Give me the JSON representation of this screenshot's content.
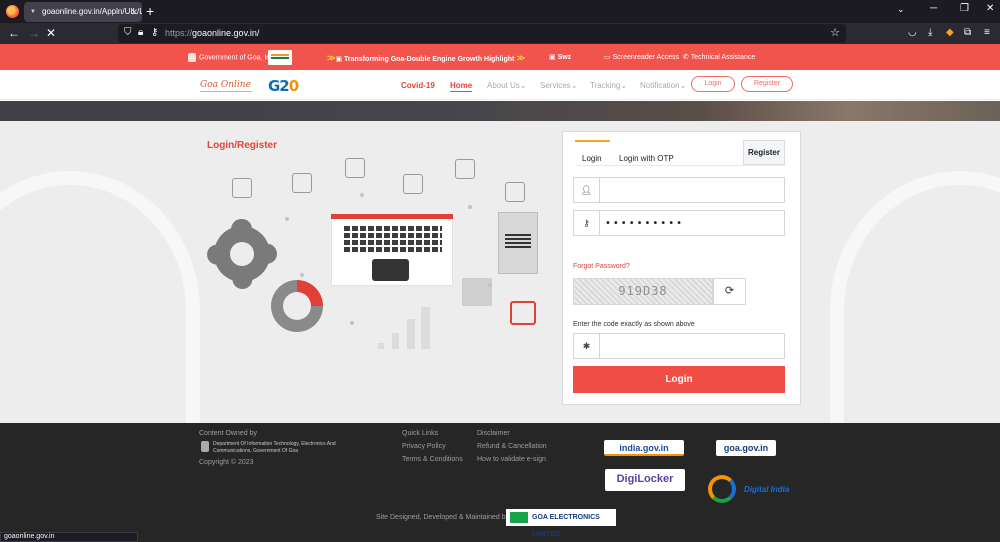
{
  "browser": {
    "tab_title": "goaonline.gov.in/Appln/UIL/Log",
    "url_scheme": "https://",
    "url_host": "goaonline.gov.in/",
    "status_url": "goaonline.gov.in"
  },
  "topstrip": {
    "gov_label": "Government of Goa, India",
    "highlight": "Transforming Goa-Double Engine Growth Highlight",
    "swaz": "Swz",
    "screenreader": "Screenreader Access",
    "technical": "Technical Assistance"
  },
  "nav": {
    "brand": "Goa Online",
    "g20": "G20",
    "links": [
      "Covid-19",
      "Home",
      "About Us",
      "Services",
      "Tracking",
      "Notification"
    ],
    "login": "Login",
    "register": "Register"
  },
  "login_register_title": "Login/Register",
  "card": {
    "tab_login": "Login",
    "tab_otp": "Login with OTP",
    "register_btn": "Register",
    "username_value": "",
    "password_value": "••••••••••",
    "forgot": "Forgot Password?",
    "captcha_text": "919D38",
    "captcha_hint": "Enter the code exactly as shown above",
    "captcha_value": "",
    "login_btn": "Login"
  },
  "footer": {
    "content_owned": "Content Owned by",
    "department": "Department Of Information Technology, Electronics And Communications, Government Of Goa",
    "copyright": "Copyright © 2023",
    "links_col1": [
      "Quick Links",
      "Privacy Policy",
      "Terms & Conditions"
    ],
    "links_col2": [
      "Disclaimer",
      "Refund & Cancellation",
      "How to validate e-sign"
    ],
    "designed_by": "Site Designed, Developed & Maintained by",
    "goa_electronics": "GOA ELECTRONICS LIMITED",
    "india_gov": "india.gov.in",
    "goa_gov": "goa.gov.in",
    "digilocker": "DigiLocker",
    "digital_india": "Digital India"
  }
}
